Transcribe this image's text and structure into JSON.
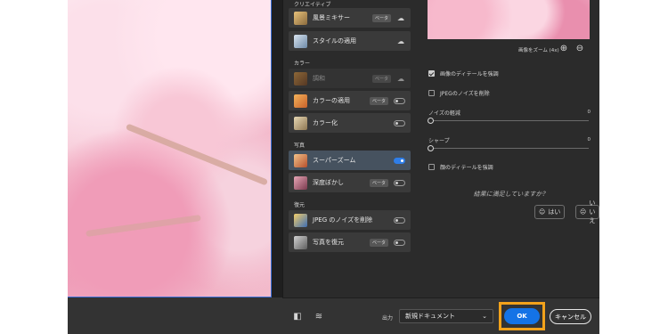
{
  "filters": {
    "sections": [
      {
        "label": "クリエイティブ"
      },
      {
        "label": "カラー"
      },
      {
        "label": "写真"
      },
      {
        "label": "復元"
      }
    ],
    "items": [
      {
        "label": "風景ミキサー",
        "beta": "ベータ",
        "action": "cloud-download-icon"
      },
      {
        "label": "スタイルの適用",
        "action": "cloud-download-icon"
      },
      {
        "label": "調和",
        "beta": "ベータ",
        "action": "cloud-download-icon",
        "state": "disabled"
      },
      {
        "label": "カラーの適用",
        "beta": "ベータ",
        "toggle": "off"
      },
      {
        "label": "カラー化",
        "toggle": "off"
      },
      {
        "label": "スーパーズーム",
        "toggle": "on",
        "selected": true
      },
      {
        "label": "深度ぼかし",
        "beta": "ベータ",
        "toggle": "off"
      },
      {
        "label": "JPEG のノイズを削除",
        "toggle": "off"
      },
      {
        "label": "写真を復元",
        "beta": "ベータ",
        "toggle": "off"
      }
    ]
  },
  "settings": {
    "zoom_label": "画像をズーム (4x)",
    "options": [
      {
        "label": "画像のディテールを強調",
        "checked": true
      },
      {
        "label": "JPEGのノイズを削除",
        "checked": false
      },
      {
        "label": "顔のディテールを強調",
        "checked": false
      }
    ],
    "sliders": [
      {
        "label": "ノイズの軽減",
        "value": "0"
      },
      {
        "label": "シャープ",
        "value": "0"
      }
    ],
    "feedback": {
      "question": "結果に満足していますか？",
      "yes_label": "はい",
      "no_label": "いいえ"
    }
  },
  "footer": {
    "output_label": "出力",
    "output_value": "新規ドキュメント",
    "ok_label": "OK",
    "cancel_label": "キャンセル"
  },
  "colors": {
    "accent": "#1473e6",
    "highlight_frame": "#f2a21b",
    "panel_bg": "#2b2b2b",
    "selected_item": "#46525f"
  }
}
